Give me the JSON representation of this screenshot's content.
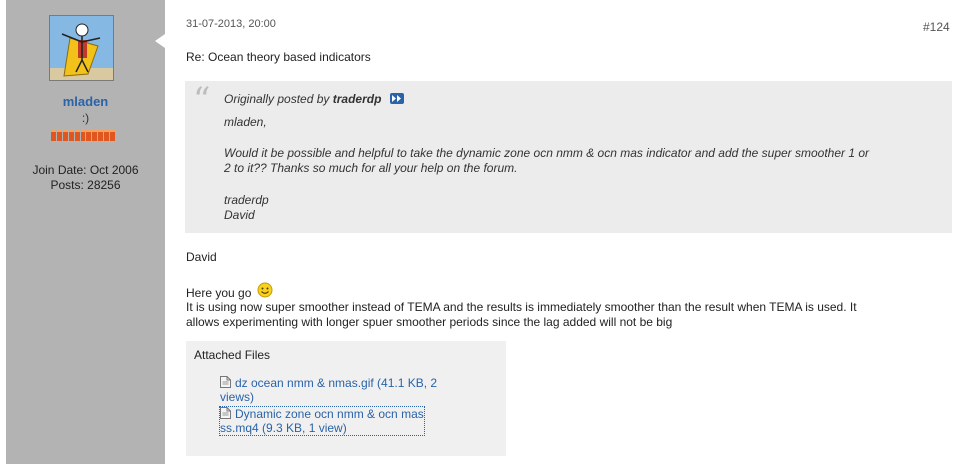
{
  "user": {
    "name": "mladen",
    "title": ":)",
    "join_date": "Join Date: Oct 2006",
    "posts": "Posts: 28256"
  },
  "post": {
    "date": "31-07-2013, 20:00",
    "number": "#124",
    "title": "Re: Ocean theory based indicators"
  },
  "quote": {
    "prefix": "Originally posted by",
    "author": "traderdp",
    "lines": [
      "mladen,",
      "Would it be possible and helpful to take the dynamic zone ocn nmm & ocn mas indicator and add the super smoother 1 or",
      "2 to it?? Thanks so much for all your help on the forum.",
      "traderdp",
      "David"
    ]
  },
  "message": {
    "greeting": "David",
    "here_you_go": "Here you go",
    "line1": "It is using now super smoother instead of TEMA and the results is immediately smoother than the result when TEMA is used. It",
    "line2": "allows experimenting with longer spuer smoother periods since the lag added will not be big"
  },
  "attachments": {
    "title": "Attached Files",
    "files": [
      {
        "line1": "dz ocean nmm & nmas.gif (41.1 KB, 2",
        "line2": "views)"
      },
      {
        "line1": "Dynamic zone ocn nmm & ocn mas",
        "line2": "ss.mq4 (9.3 KB, 1 view)"
      }
    ]
  },
  "colors": {
    "sidebar": "#b3b3b3",
    "link": "#2a63a8",
    "quote_bg": "#ececec"
  },
  "icons": [
    "avatar-image",
    "view-post-icon",
    "smiley-icon",
    "file-icon"
  ]
}
